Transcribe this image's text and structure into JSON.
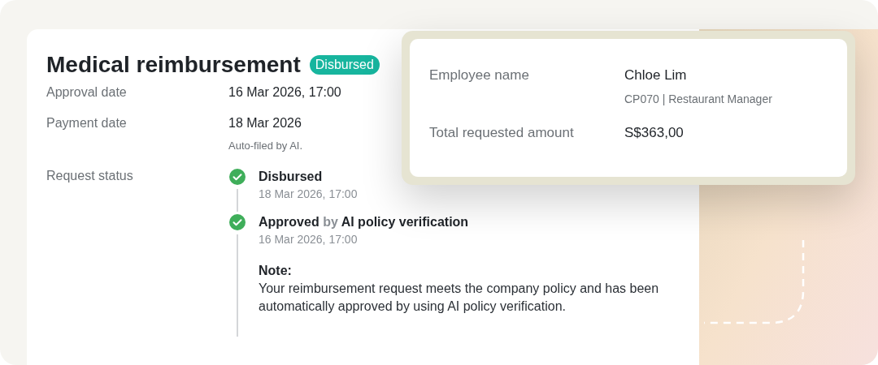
{
  "title": "Medical reimbursement",
  "status_badge": "Disbursed",
  "fields": [
    {
      "label": "Approval date",
      "value": "16 Mar 2026, 17:00"
    },
    {
      "label": "Payment date",
      "value": "18 Mar 2026",
      "note": "Auto-filed by AI."
    }
  ],
  "request_status": {
    "label": "Request status",
    "steps": [
      {
        "title": "Disbursed",
        "time": "18 Mar 2026, 17:00",
        "done": true
      },
      {
        "title": "Approved",
        "connector": "by",
        "actor": "AI policy verification",
        "time": "16 Mar 2026, 17:00",
        "done": true,
        "note_label": "Note:",
        "note": "Your reimbursement request meets the company policy and has been automatically approved by using AI policy verification."
      }
    ]
  },
  "employee_card": {
    "rows": [
      {
        "label": "Employee name",
        "value": "Chloe Lim",
        "detail": "CP070 | Restaurant Manager"
      },
      {
        "label": "Total requested amount",
        "value": "S$363,00"
      }
    ]
  }
}
